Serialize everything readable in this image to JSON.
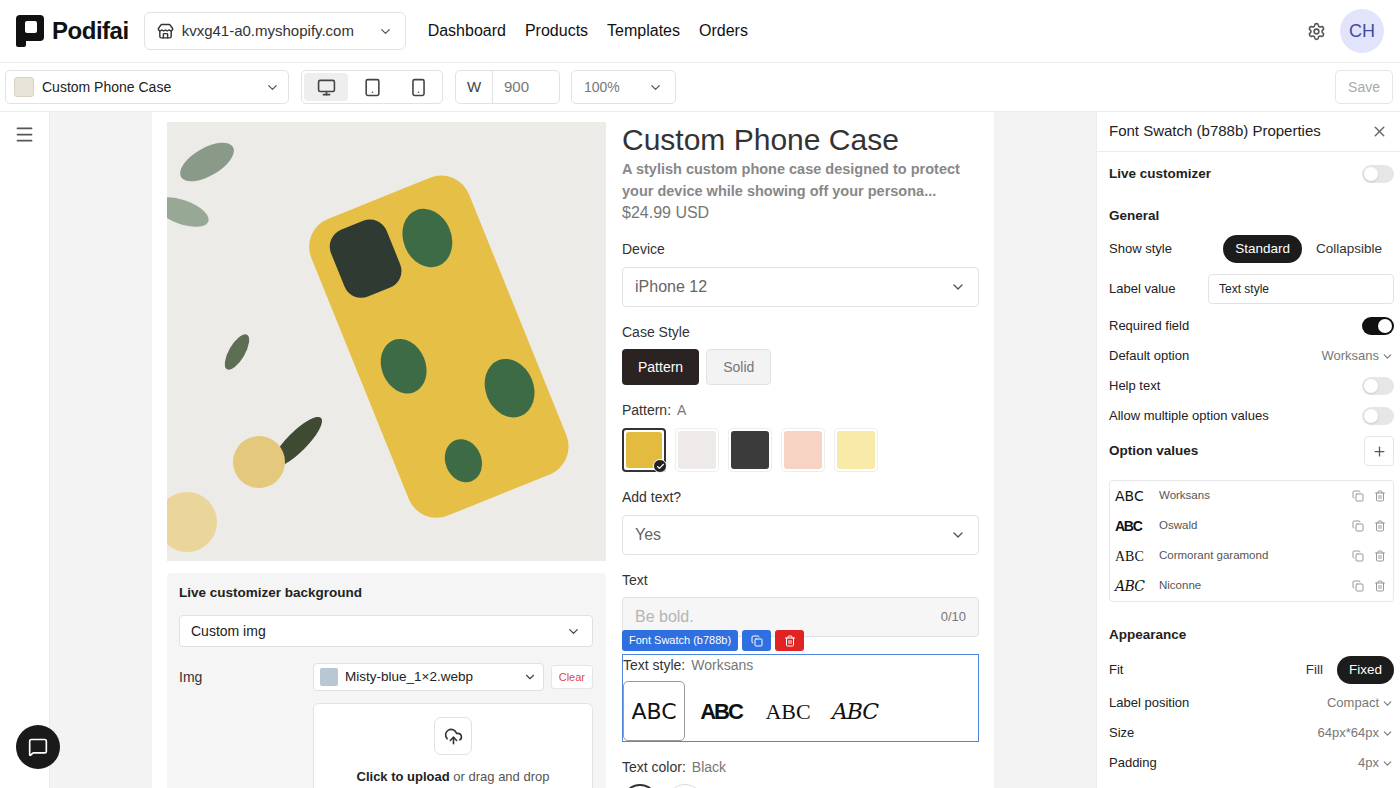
{
  "header": {
    "logo": "Podifai",
    "store": "kvxg41-a0.myshopify.com",
    "nav": [
      {
        "label": "Dashboard"
      },
      {
        "label": "Products"
      },
      {
        "label": "Templates"
      },
      {
        "label": "Orders"
      }
    ],
    "avatar": "CH"
  },
  "toolbar": {
    "product": "Custom Phone Case",
    "devices": [
      {
        "kind": "desktop",
        "selected": true
      },
      {
        "kind": "tablet",
        "selected": false
      },
      {
        "kind": "phone",
        "selected": false
      }
    ],
    "width_label": "W",
    "width": "900",
    "zoom": "100%",
    "save": {
      "label": "Save",
      "disabled": true
    }
  },
  "background_panel": {
    "title": "Live customizer background",
    "mode": "Custom img",
    "img_label": "Img",
    "img_file": "Misty-blue_1×2.webp",
    "clear": "Clear",
    "upload_action": "Click to upload",
    "upload_rest": "or drag and drop"
  },
  "product": {
    "title": "Custom Phone Case",
    "description": "A stylish custom phone case designed to protect your device while showing off your persona...",
    "price": "$24.99 USD",
    "fields": [
      {
        "kind": "select",
        "label": "Device",
        "value": "iPhone 12"
      },
      {
        "kind": "buttons",
        "label": "Case Style",
        "options": [
          {
            "label": "Pattern",
            "selected": true
          },
          {
            "label": "Solid",
            "selected": false
          }
        ]
      },
      {
        "kind": "swatches",
        "label": "Pattern:",
        "value": "A",
        "options": [
          {
            "color": "#e3bb3e",
            "selected": true
          },
          {
            "color": "#efeaea",
            "selected": false
          },
          {
            "color": "#3b3b3b",
            "selected": false
          },
          {
            "color": "#f7d3c4",
            "selected": false
          },
          {
            "color": "#f8eaa8",
            "selected": false
          }
        ]
      },
      {
        "kind": "select",
        "label": "Add text?",
        "value": "Yes"
      },
      {
        "kind": "text",
        "label": "Text",
        "placeholder": "Be bold.",
        "counter": "0/10"
      },
      {
        "kind": "font_swatch",
        "label": "Text style:",
        "value": "Worksans",
        "badge": "Font Swatch (b788b)",
        "options": [
          {
            "sample": "ABC",
            "font": "sans",
            "selected": true
          },
          {
            "sample": "ABC",
            "font": "condensed",
            "selected": false
          },
          {
            "sample": "ABC",
            "font": "serif",
            "selected": false
          },
          {
            "sample": "ABC",
            "font": "script",
            "selected": false
          }
        ]
      },
      {
        "kind": "color",
        "label": "Text color:",
        "value": "Black",
        "options": [
          {
            "color": "#111111",
            "selected": true
          },
          {
            "color": "#ffffff",
            "selected": false
          }
        ]
      }
    ]
  },
  "properties": {
    "title": "Font Swatch (b788b) Properties",
    "live_customizer": {
      "label": "Live customizer",
      "on": false
    },
    "general": {
      "title": "General",
      "rows": [
        {
          "kind": "segmented",
          "label": "Show style",
          "options": [
            {
              "label": "Standard",
              "selected": true
            },
            {
              "label": "Collapsible",
              "selected": false
            }
          ]
        },
        {
          "kind": "input",
          "label": "Label value",
          "value": "Text style"
        },
        {
          "kind": "toggle",
          "label": "Required field",
          "on": true
        },
        {
          "kind": "dropdown",
          "label": "Default option",
          "value": "Worksans"
        },
        {
          "kind": "toggle",
          "label": "Help text",
          "on": false
        },
        {
          "kind": "toggle",
          "label": "Allow multiple option values",
          "on": false
        }
      ]
    },
    "option_values": {
      "title": "Option values",
      "items": [
        {
          "sample": "ABC",
          "font": "sans",
          "name": "Worksans"
        },
        {
          "sample": "ABC",
          "font": "condensed",
          "name": "Oswald"
        },
        {
          "sample": "ABC",
          "font": "serif",
          "name": "Cormorant garamond"
        },
        {
          "sample": "ABC",
          "font": "script",
          "name": "Niconne"
        }
      ]
    },
    "appearance": {
      "title": "Appearance",
      "rows": [
        {
          "kind": "segmented",
          "label": "Fit",
          "options": [
            {
              "label": "Fill",
              "selected": false
            },
            {
              "label": "Fixed",
              "selected": true
            }
          ]
        },
        {
          "kind": "dropdown",
          "label": "Label position",
          "value": "Compact"
        },
        {
          "kind": "dropdown",
          "label": "Size",
          "value": "64px*64px"
        },
        {
          "kind": "dropdown",
          "label": "Padding",
          "value": "4px"
        }
      ]
    }
  }
}
